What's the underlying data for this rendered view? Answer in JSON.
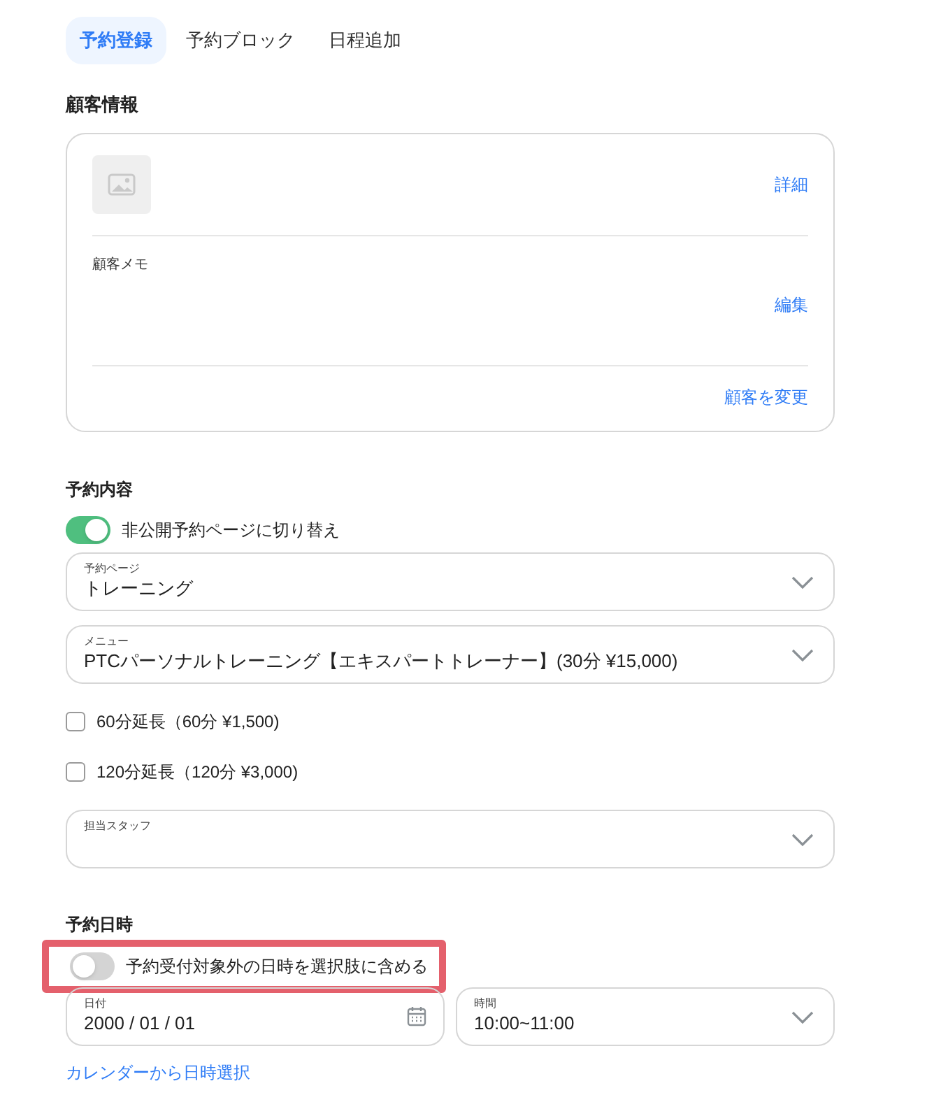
{
  "tabs": [
    {
      "label": "予約登録",
      "selected": true
    },
    {
      "label": "予約ブロック",
      "selected": false
    },
    {
      "label": "日程追加",
      "selected": false
    }
  ],
  "customer_section": {
    "heading": "顧客情報",
    "details_link": "詳細",
    "memo_label": "顧客メモ",
    "edit_link": "編集",
    "change_link": "顧客を変更"
  },
  "booking_section": {
    "heading": "予約内容",
    "private_toggle": {
      "label": "非公開予約ページに切り替え",
      "on": true
    },
    "booking_page": {
      "label": "予約ページ",
      "value": "トレーニング"
    },
    "menu": {
      "label": "メニュー",
      "value": "PTCパーソナルトレーニング【エキスパートトレーナー】(30分 ¥15,000)"
    },
    "options": [
      {
        "label": "60分延長（60分 ¥1,500)",
        "checked": false
      },
      {
        "label": "120分延長（120分 ¥3,000)",
        "checked": false
      }
    ],
    "staff": {
      "label": "担当スタッフ"
    }
  },
  "datetime_section": {
    "heading": "予約日時",
    "outside_toggle": {
      "label": "予約受付対象外の日時を選択肢に含める",
      "on": false,
      "highlighted": true
    },
    "date": {
      "label": "日付",
      "value": "2000 / 01 / 01"
    },
    "time": {
      "label": "時間",
      "value": "10:00~11:00"
    },
    "calendar_link": "カレンダーから日時選択"
  }
}
